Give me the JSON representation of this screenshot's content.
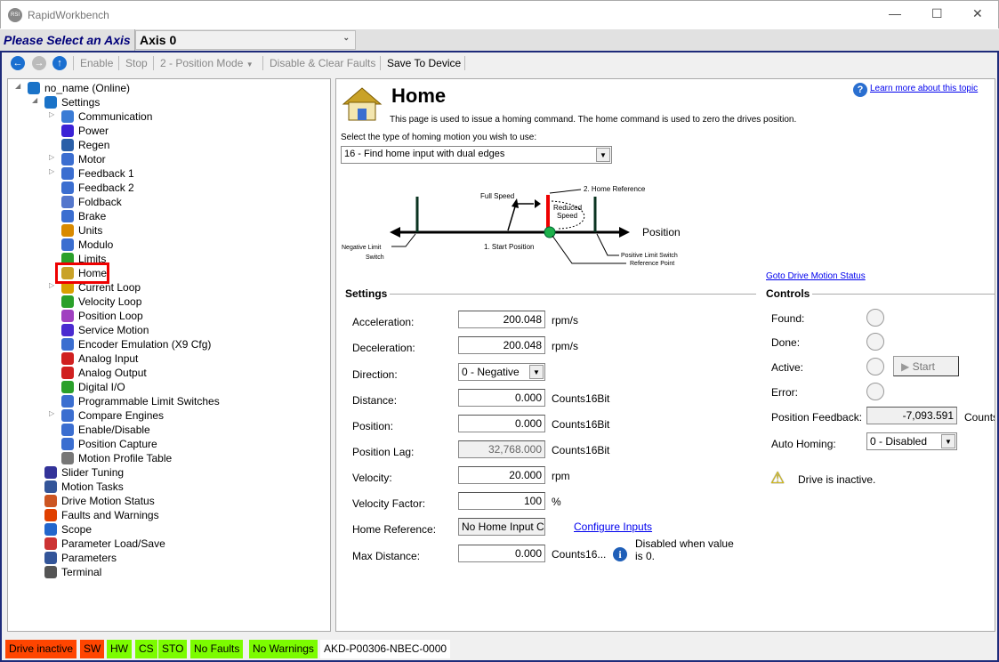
{
  "window": {
    "title": "RapidWorkbench",
    "logo_text": "RSI"
  },
  "axis": {
    "label": "Please Select an Axis",
    "selected": "Axis 0"
  },
  "toolbar": {
    "enable": "Enable",
    "stop": "Stop",
    "mode": "2 - Position Mode",
    "disable_clear": "Disable & Clear Faults",
    "save": "Save To Device"
  },
  "tree": {
    "items": [
      {
        "label": "no_name (Online)",
        "level": 0,
        "expanded": true,
        "color": "#1a73c8"
      },
      {
        "label": "Settings",
        "level": 1,
        "expanded": true,
        "color": "#1a73c8"
      },
      {
        "label": "Communication",
        "level": 2,
        "collapsed": true,
        "color": "#3a7bd5"
      },
      {
        "label": "Power",
        "level": 2,
        "color": "#3b22d6"
      },
      {
        "label": "Regen",
        "level": 2,
        "color": "#2a5fa8"
      },
      {
        "label": "Motor",
        "level": 2,
        "collapsed": true,
        "color": "#3b6ed0"
      },
      {
        "label": "Feedback 1",
        "level": 2,
        "collapsed": true,
        "color": "#3b6ed0"
      },
      {
        "label": "Feedback 2",
        "level": 2,
        "color": "#3b6ed0"
      },
      {
        "label": "Foldback",
        "level": 2,
        "color": "#5577cc"
      },
      {
        "label": "Brake",
        "level": 2,
        "color": "#3b6ed0"
      },
      {
        "label": "Units",
        "level": 2,
        "color": "#d98a00"
      },
      {
        "label": "Modulo",
        "level": 2,
        "color": "#3b6ed0"
      },
      {
        "label": "Limits",
        "level": 2,
        "color": "#2aa02a"
      },
      {
        "label": "Home",
        "level": 2,
        "color": "#c9a227",
        "selected_highlight": true
      },
      {
        "label": "Current Loop",
        "level": 2,
        "collapsed": true,
        "color": "#d9a000"
      },
      {
        "label": "Velocity Loop",
        "level": 2,
        "color": "#2aa02a"
      },
      {
        "label": "Position Loop",
        "level": 2,
        "color": "#a040c0"
      },
      {
        "label": "Service Motion",
        "level": 2,
        "color": "#4a2ad0"
      },
      {
        "label": "Encoder Emulation (X9 Cfg)",
        "level": 2,
        "color": "#3b6ed0"
      },
      {
        "label": "Analog Input",
        "level": 2,
        "color": "#d02020"
      },
      {
        "label": "Analog Output",
        "level": 2,
        "color": "#d02020"
      },
      {
        "label": "Digital I/O",
        "level": 2,
        "color": "#2aa02a"
      },
      {
        "label": "Programmable Limit Switches",
        "level": 2,
        "color": "#3b6ed0"
      },
      {
        "label": "Compare Engines",
        "level": 2,
        "collapsed": true,
        "color": "#3b6ed0"
      },
      {
        "label": "Enable/Disable",
        "level": 2,
        "color": "#3b6ed0"
      },
      {
        "label": "Position Capture",
        "level": 2,
        "color": "#3b6ed0"
      },
      {
        "label": "Motion Profile Table",
        "level": 2,
        "color": "#777777"
      },
      {
        "label": "Slider Tuning",
        "level": 1,
        "color": "#333399"
      },
      {
        "label": "Motion Tasks",
        "level": 1,
        "color": "#335599"
      },
      {
        "label": "Drive Motion Status",
        "level": 1,
        "color": "#cc5522"
      },
      {
        "label": "Faults and Warnings",
        "level": 1,
        "color": "#e04000"
      },
      {
        "label": "Scope",
        "level": 1,
        "color": "#2266cc"
      },
      {
        "label": "Parameter Load/Save",
        "level": 1,
        "color": "#cc3333"
      },
      {
        "label": "Parameters",
        "level": 1,
        "color": "#335599"
      },
      {
        "label": "Terminal",
        "level": 1,
        "color": "#555555"
      }
    ]
  },
  "page": {
    "title": "Home",
    "description": "This page is used to issue a homing command. The home command is used to zero the drives position.",
    "learn_more": "Learn more about this topic",
    "select_prompt": "Select the type of homing motion you wish to use:",
    "homing_type": "16 - Find home input with dual edges",
    "diagram": {
      "full_speed": "Full Speed",
      "home_reference": "2. Home Reference",
      "reduced_speed_1": "Reduced",
      "reduced_speed_2": "Speed",
      "position": "Position",
      "neg_limit_1": "Negative Limit",
      "neg_limit_2": "Switch",
      "start_position": "1. Start Position",
      "pos_limit": "Positive Limit Switch",
      "reference_point": "Reference Point"
    },
    "goto_status": "Goto Drive Motion Status",
    "settings": {
      "title": "Settings",
      "rows": [
        {
          "label": "Acceleration:",
          "value": "200.048",
          "unit": "rpm/s"
        },
        {
          "label": "Deceleration:",
          "value": "200.048",
          "unit": "rpm/s"
        },
        {
          "label": "Direction:",
          "value": "0 - Negative",
          "type": "select"
        },
        {
          "label": "Distance:",
          "value": "0.000",
          "unit": "Counts16Bit"
        },
        {
          "label": "Position:",
          "value": "0.000",
          "unit": "Counts16Bit"
        },
        {
          "label": "Position Lag:",
          "value": "32,768.000",
          "unit": "Counts16Bit",
          "readonly": true
        },
        {
          "label": "Velocity:",
          "value": "20.000",
          "unit": "rpm"
        },
        {
          "label": "Velocity Factor:",
          "value": "100",
          "unit": "%"
        },
        {
          "label": "Home Reference:",
          "value": "No Home Input Con",
          "readonly": true,
          "link": "Configure Inputs"
        },
        {
          "label": "Max Distance:",
          "value": "0.000",
          "unit": "Counts16...",
          "note": "Disabled when value is 0."
        }
      ]
    },
    "controls": {
      "title": "Controls",
      "found": "Found:",
      "done": "Done:",
      "active": "Active:",
      "error": "Error:",
      "start": "Start",
      "position_feedback_label": "Position Feedback:",
      "position_feedback": "-7,093.591",
      "position_feedback_unit": "Counts",
      "auto_homing_label": "Auto Homing:",
      "auto_homing": "0 - Disabled",
      "drive_msg": "Drive is inactive."
    }
  },
  "status": [
    {
      "text": "Drive inactive",
      "color": "#ff4500"
    },
    {
      "text": "SW",
      "color": "#ff4500"
    },
    {
      "text": "HW",
      "color": "#7cfc00"
    },
    {
      "text": "CS",
      "color": "#7cfc00"
    },
    {
      "text": "STO",
      "color": "#7cfc00"
    },
    {
      "text": "No Faults",
      "color": "#7cfc00"
    },
    {
      "text": "No Warnings",
      "color": "#7cfc00"
    },
    {
      "text": "AKD-P00306-NBEC-0000",
      "color": "#ffffff"
    }
  ]
}
